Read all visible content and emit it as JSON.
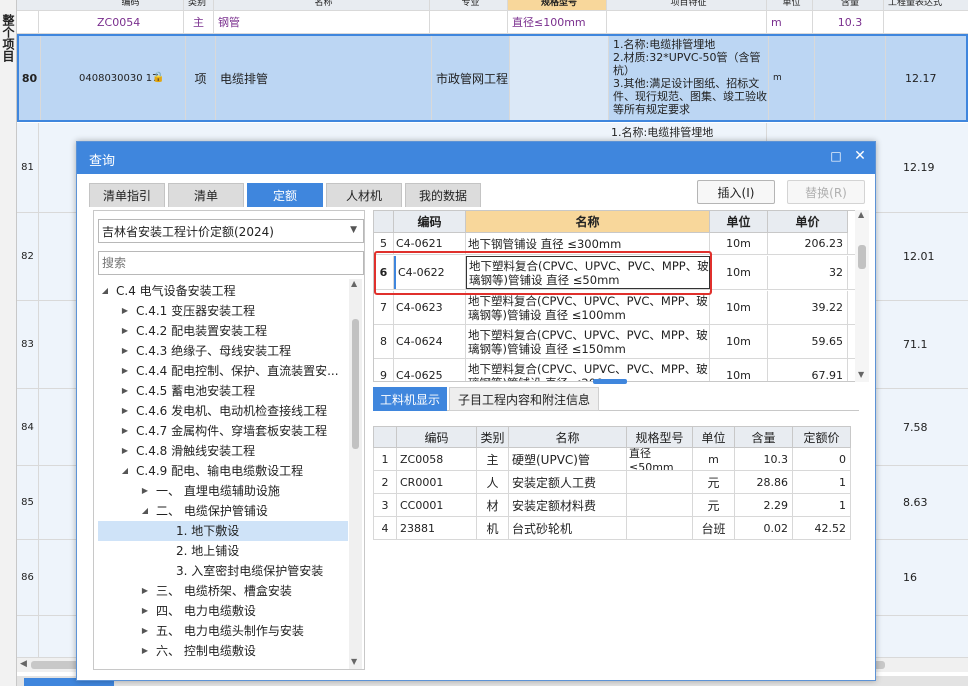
{
  "background": {
    "left_strip_text": "整个项目",
    "header_fragments": [
      "编码",
      "类别",
      "名称",
      "专业",
      "规格型号",
      "项目特征",
      "单位",
      "含量",
      "工程量表达式"
    ],
    "sub_row": {
      "code": "ZC0054",
      "type": "主",
      "name": "钢管",
      "spec": "直径≤100mm",
      "unit": "m",
      "qty": "10.3"
    },
    "row80": {
      "num": "80",
      "code": "0408030030 17",
      "type": "项",
      "name": "电缆排管",
      "major": "市政管网工程",
      "feature": "1.名称:电缆排管埋地\n2.材质:32*UPVC-50管（含管杭）\n3.其他:满足设计图纸、招标文件、现行规范、图集、竣工验收等所有规定要求",
      "unit": "m",
      "qty": "12.17"
    },
    "row81": {
      "num": "81",
      "feature": "1.名称:电缆排管埋地",
      "qty": "12.19"
    },
    "rows": [
      {
        "num": "82",
        "qty": "12.01"
      },
      {
        "num": "83",
        "qty": "71.1"
      },
      {
        "num": "84",
        "qty": "7.58"
      },
      {
        "num": "85",
        "qty": "8.63"
      },
      {
        "num": "86",
        "qty": "16"
      }
    ]
  },
  "dialog": {
    "title": "查询",
    "tabs": [
      {
        "label": "清单指引",
        "active": false
      },
      {
        "label": "清单",
        "active": false
      },
      {
        "label": "定额",
        "active": true
      },
      {
        "label": "人材机",
        "active": false
      },
      {
        "label": "我的数据",
        "active": false
      }
    ],
    "insert_label": "插入(I)",
    "replace_label": "替换(R)",
    "library_select": "吉林省安装工程计价定额(2024)",
    "search_placeholder": "搜索",
    "tree": [
      {
        "label": "C.4 电气设备安装工程",
        "level": 0,
        "arrow": "down"
      },
      {
        "label": "C.4.1 变压器安装工程",
        "level": 1,
        "arrow": "right"
      },
      {
        "label": "C.4.2 配电装置安装工程",
        "level": 1,
        "arrow": "right"
      },
      {
        "label": "C.4.3 绝缘子、母线安装工程",
        "level": 1,
        "arrow": "right"
      },
      {
        "label": "C.4.4 配电控制、保护、直流装置安...",
        "level": 1,
        "arrow": "right"
      },
      {
        "label": "C.4.5 蓄电池安装工程",
        "level": 1,
        "arrow": "right"
      },
      {
        "label": "C.4.6 发电机、电动机检查接线工程",
        "level": 1,
        "arrow": "right"
      },
      {
        "label": "C.4.7 金属构件、穿墙套板安装工程",
        "level": 1,
        "arrow": "right"
      },
      {
        "label": "C.4.8 滑触线安装工程",
        "level": 1,
        "arrow": "right"
      },
      {
        "label": "C.4.9 配电、输电电缆敷设工程",
        "level": 1,
        "arrow": "down"
      },
      {
        "label": "一、 直埋电缆辅助设施",
        "level": 2,
        "arrow": "right"
      },
      {
        "label": "二、 电缆保护管铺设",
        "level": 2,
        "arrow": "down"
      },
      {
        "label": "1. 地下敷设",
        "level": 3,
        "arrow": "",
        "selected": true
      },
      {
        "label": "2. 地上铺设",
        "level": 3,
        "arrow": ""
      },
      {
        "label": "3. 入室密封电缆保护管安装",
        "level": 3,
        "arrow": ""
      },
      {
        "label": "三、 电缆桥架、槽盒安装",
        "level": 2,
        "arrow": "right"
      },
      {
        "label": "四、 电力电缆敷设",
        "level": 2,
        "arrow": "right"
      },
      {
        "label": "五、 电力电缆头制作与安装",
        "level": 2,
        "arrow": "right"
      },
      {
        "label": "六、 控制电缆敷设",
        "level": 2,
        "arrow": "right"
      }
    ],
    "quota_table": {
      "headers": [
        "编码",
        "名称",
        "单位",
        "单价"
      ],
      "rows": [
        {
          "idx": "5",
          "code": "C4-0621",
          "name": "地下钢管铺设 直径 ≤300mm",
          "unit": "10m",
          "price": "206.23"
        },
        {
          "idx": "6",
          "code": "C4-0622",
          "name": "地下塑料复合(CPVC、UPVC、PVC、MPP、玻璃钢等)管铺设 直径 ≤50mm",
          "unit": "10m",
          "price": "32",
          "selected": true
        },
        {
          "idx": "7",
          "code": "C4-0623",
          "name": "地下塑料复合(CPVC、UPVC、PVC、MPP、玻璃钢等)管铺设 直径 ≤100mm",
          "unit": "10m",
          "price": "39.22"
        },
        {
          "idx": "8",
          "code": "C4-0624",
          "name": "地下塑料复合(CPVC、UPVC、PVC、MPP、玻璃钢等)管铺设 直径 ≤150mm",
          "unit": "10m",
          "price": "59.65"
        },
        {
          "idx": "9",
          "code": "C4-0625",
          "name": "地下塑料复合(CPVC、UPVC、PVC、MPP、玻璃钢等)管铺设 直径 ≤200mm",
          "unit": "10m",
          "price": "67.91"
        }
      ]
    },
    "sub_tabs": [
      {
        "label": "工料机显示",
        "active": true
      },
      {
        "label": "子目工程内容和附注信息",
        "active": false
      }
    ],
    "resource_table": {
      "headers": [
        "编码",
        "类别",
        "名称",
        "规格型号",
        "单位",
        "含量",
        "定额价"
      ],
      "rows": [
        {
          "idx": "1",
          "code": "ZC0058",
          "type": "主",
          "name": "硬塑(UPVC)管",
          "spec": "直径≤50mm",
          "unit": "m",
          "qty": "10.3",
          "price": "0"
        },
        {
          "idx": "2",
          "code": "CR0001",
          "type": "人",
          "name": "安装定额人工费",
          "spec": "",
          "unit": "元",
          "qty": "28.86",
          "price": "1"
        },
        {
          "idx": "3",
          "code": "CC0001",
          "type": "材",
          "name": "安装定额材料费",
          "spec": "",
          "unit": "元",
          "qty": "2.29",
          "price": "1"
        },
        {
          "idx": "4",
          "code": "23881",
          "type": "机",
          "name": "台式砂轮机",
          "spec": "",
          "unit": "台班",
          "qty": "0.02",
          "price": "42.52"
        }
      ]
    }
  }
}
